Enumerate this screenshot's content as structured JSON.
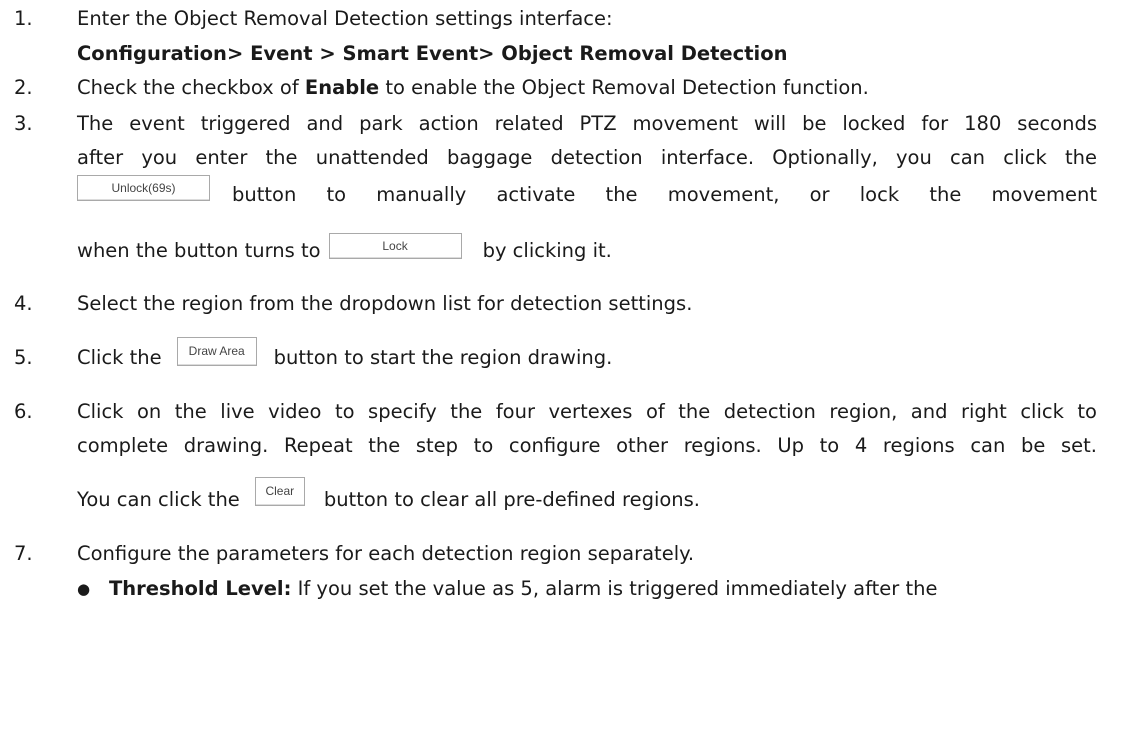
{
  "steps": [
    {
      "num": "1.",
      "lines": [
        "Enter the Object Removal Detection settings interface:"
      ],
      "path": "Configuration> Event > Smart Event> Object Removal Detection"
    },
    {
      "num": "2.",
      "pre": "Check the checkbox of ",
      "bold": "Enable",
      "post": " to enable the Object Removal Detection function."
    },
    {
      "num": "3.",
      "line1": "The event triggered and park action related PTZ movement will be locked for 180 seconds",
      "line2": "after you enter the unattended baggage detection interface. Optionally, you can click the",
      "after_unlock": "button to manually activate the movement, or lock the movement",
      "when_pre": "when the button turns to",
      "when_post": "by clicking it."
    },
    {
      "num": "4.",
      "text": "Select the region from the dropdown list for detection settings."
    },
    {
      "num": "5.",
      "pre": "Click the",
      "post": "button to start the region drawing."
    },
    {
      "num": "6.",
      "line1": "Click on the live video to specify the four vertexes of the detection region, and right click to",
      "line2": "complete drawing. Repeat the step to configure other regions. Up to 4 regions can be set.",
      "pre": "You can click the",
      "post": "button to clear all pre-defined regions."
    },
    {
      "num": "7.",
      "text": "Configure the parameters for each detection region separately."
    }
  ],
  "bullet": {
    "symbol": "●",
    "bold": "Threshold Level:",
    "text": " If you set the value as 5, alarm is triggered immediately after the"
  },
  "buttons": {
    "unlock": "Unlock(69s)",
    "lock": "Lock",
    "draw_area": "Draw Area",
    "clear": "Clear"
  }
}
